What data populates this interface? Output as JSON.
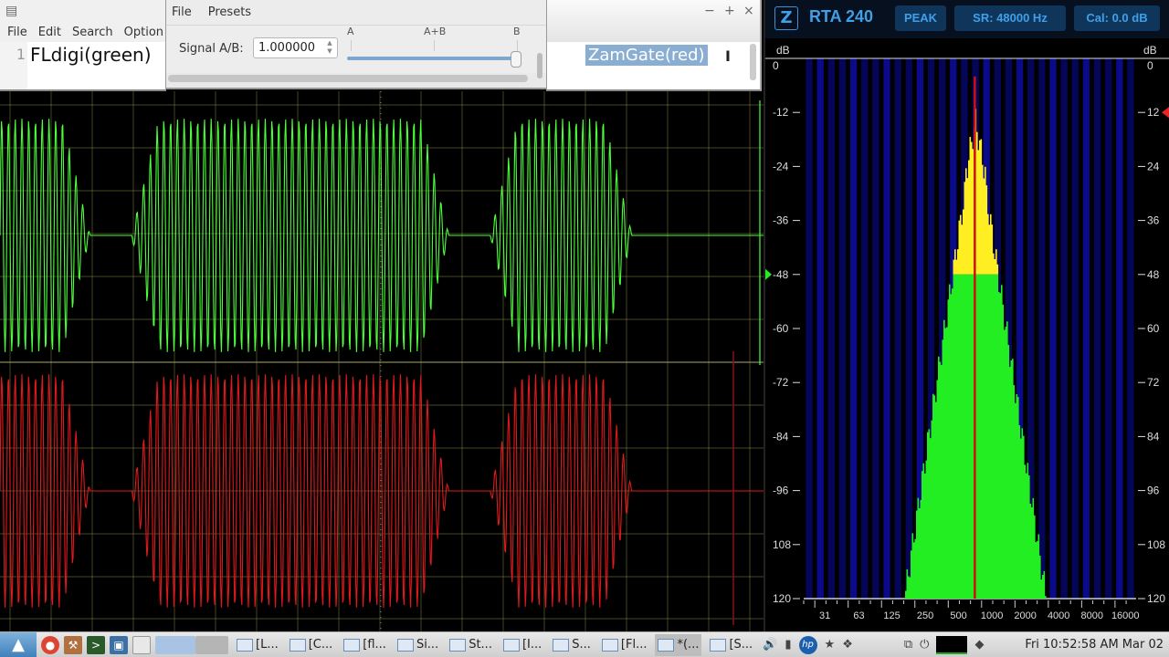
{
  "notepad_left": {
    "menu": [
      "File",
      "Edit",
      "Search",
      "Option"
    ],
    "line_number": "1",
    "line_text": "FLdigi(green)",
    "icon": "notepad-icon"
  },
  "mixer": {
    "menu": [
      "File",
      "Presets"
    ],
    "signal_label": "Signal A/B:",
    "signal_value": "1.000000",
    "ticks": [
      "A",
      "A+B",
      "B"
    ],
    "slider_position": 1.0
  },
  "notepad_right": {
    "window_controls": {
      "minimize": "−",
      "maximize": "+",
      "close": "×"
    },
    "selected_text": "ZamGate(red)"
  },
  "scope": {
    "trace_a_color": "#4cff3a",
    "trace_b_color": "#e0191c",
    "grid_color": "#8a8a4a",
    "bursts": [
      {
        "start": 0.0,
        "end": 0.1
      },
      {
        "start": 0.19,
        "end": 0.57
      },
      {
        "start": 0.66,
        "end": 0.81
      }
    ]
  },
  "rta": {
    "logo": "Z",
    "title": "RTA 240",
    "mode": "PEAK",
    "sample_rate": "SR: 48000 Hz",
    "calibration": "Cal: 0.0 dB",
    "axis_unit_left": "dB",
    "axis_unit_right": "dB",
    "db_ticks": [
      "0",
      "-12",
      "-24",
      "-36",
      "-48",
      "-60",
      "-72",
      "-84",
      "-96",
      "108",
      "120"
    ],
    "db_ticks_right": [
      "0",
      "-12",
      "-24",
      "-36",
      "-48",
      "-60",
      "-72",
      "-84",
      "-96",
      "-108",
      "-120"
    ],
    "freq_ticks": [
      "31",
      "63",
      "125",
      "250",
      "500",
      "1000",
      "2000",
      "4000",
      "8000",
      "16000"
    ],
    "green_marker_db": -48,
    "red_marker_db": -12,
    "peak_freq_hz": 700
  },
  "taskbar": {
    "tasks": [
      {
        "label": "[L...",
        "icon": "window-icon"
      },
      {
        "label": "[C...",
        "icon": "red-app-icon"
      },
      {
        "label": "[fl...",
        "icon": "film-icon"
      },
      {
        "label": "Si...",
        "icon": "window-icon"
      },
      {
        "label": "St...",
        "icon": "window-icon"
      },
      {
        "label": "[I...",
        "icon": "green-app-icon"
      },
      {
        "label": "S...",
        "icon": "s-app-icon"
      },
      {
        "label": "[Fl...",
        "icon": "folder-icon"
      },
      {
        "label": "*(...",
        "icon": "notepad-icon"
      },
      {
        "label": "[S...",
        "icon": "window-icon"
      }
    ],
    "clock": "Fri 10:52:58 AM Mar 02"
  }
}
